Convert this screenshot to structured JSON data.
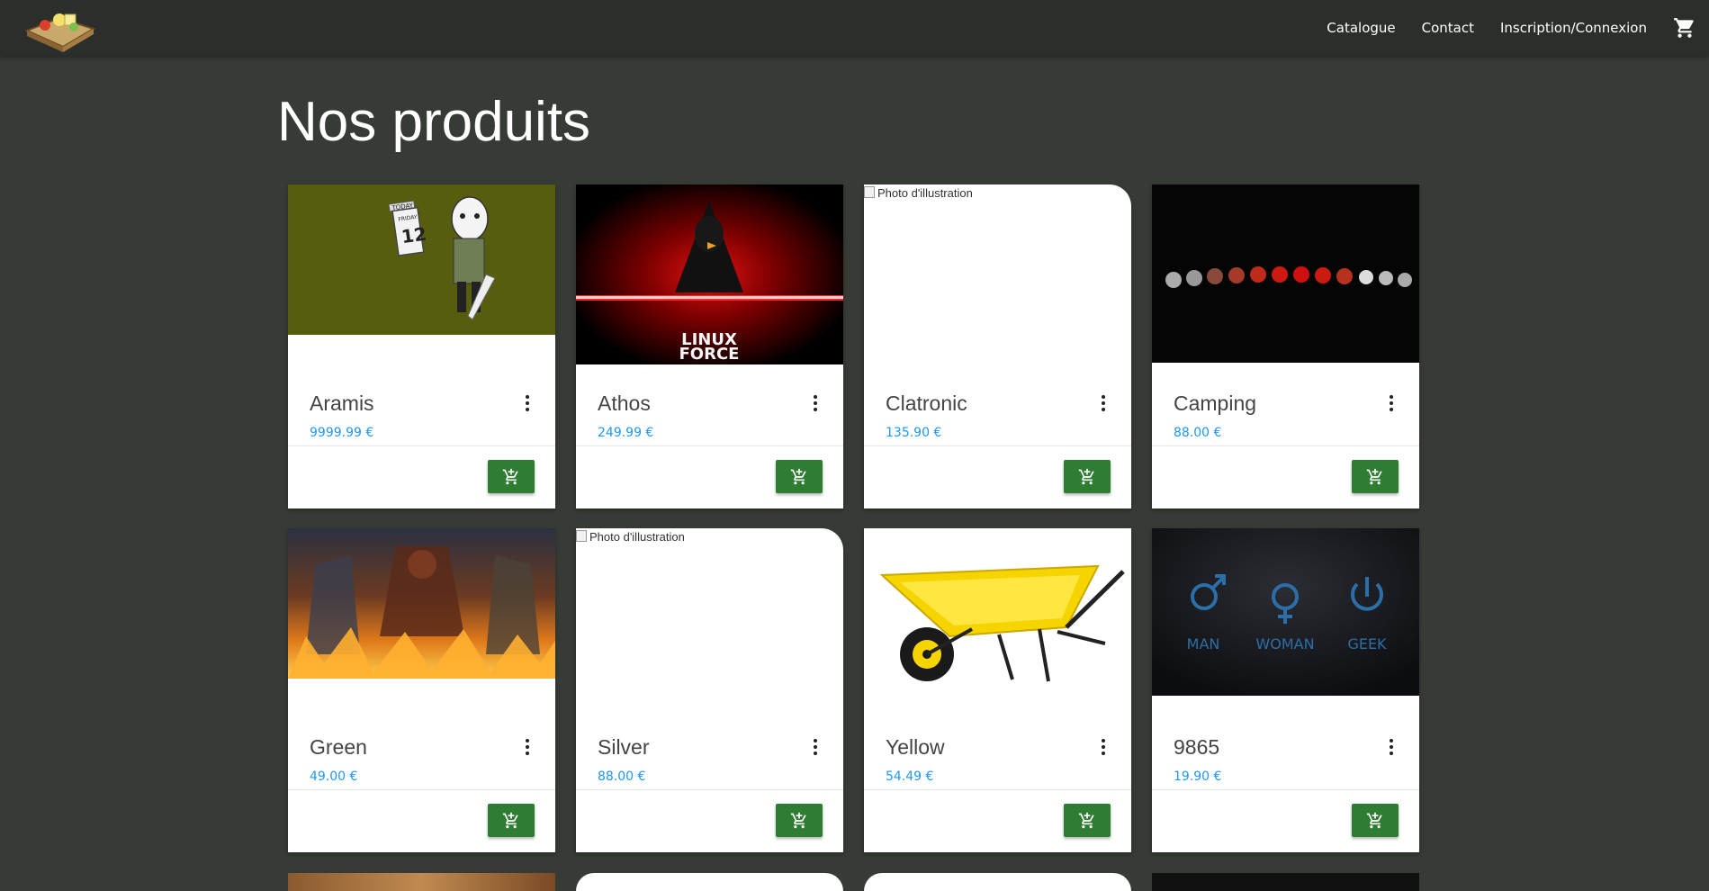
{
  "nav": {
    "links": [
      "Catalogue",
      "Contact",
      "Inscription/Connexion"
    ]
  },
  "page_title": "Nos produits",
  "image_alt": "Photo d'illustration",
  "products": [
    {
      "name": "Aramis",
      "price": "9999.99 €",
      "image": "friday-13th-cartoon"
    },
    {
      "name": "Athos",
      "price": "249.99 €",
      "image": "linux-force-penguin"
    },
    {
      "name": "Clatronic",
      "price": "135.90 €",
      "image": "broken-image"
    },
    {
      "name": "Camping",
      "price": "88.00 €",
      "image": "lunar-eclipse-phases"
    },
    {
      "name": "Green",
      "price": "49.00 €",
      "image": "fantasy-fire-warriors"
    },
    {
      "name": "Silver",
      "price": "88.00 €",
      "image": "broken-image"
    },
    {
      "name": "Yellow",
      "price": "54.49 €",
      "image": "yellow-wheelbarrow"
    },
    {
      "name": "9865",
      "price": "19.90 €",
      "image": "man-woman-geek"
    }
  ],
  "friday_calendar": {
    "top": "TODAY",
    "day": "FRIDAY",
    "number": "12"
  },
  "linux_logo": {
    "line1": "LINUX",
    "line2": "FORCE"
  },
  "geek_labels": [
    "MAN",
    "WOMAN",
    "GEEK"
  ],
  "colors": {
    "background": "#373b35",
    "navbar": "#2b2e2a",
    "price": "#2196f3",
    "add_button": "#2e7d32"
  }
}
